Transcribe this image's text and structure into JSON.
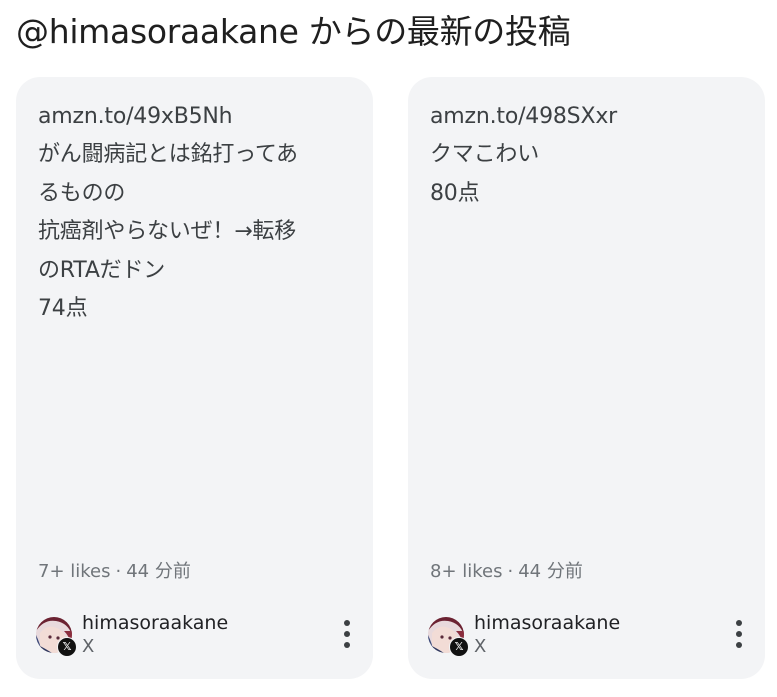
{
  "section_title": "@himasoraakane からの最新の投稿",
  "posts": [
    {
      "lines": [
        "amzn.to/49xB5Nh",
        "がん闘病記とは銘打ってあ",
        "るものの",
        "抗癌剤やらないぜ！→転移",
        "のRTAだドン",
        "74点"
      ],
      "likes": "7+ likes",
      "separator": "·",
      "time": "44 分前",
      "author": "himasoraakane",
      "platform": "X",
      "platform_icon": "x-logo-icon",
      "more_icon": "more-vert-icon"
    },
    {
      "lines": [
        "amzn.to/498SXxr",
        "クマこわい",
        "80点"
      ],
      "likes": "8+ likes",
      "separator": "·",
      "time": "44 分前",
      "author": "himasoraakane",
      "platform": "X",
      "platform_icon": "x-logo-icon",
      "more_icon": "more-vert-icon"
    }
  ]
}
